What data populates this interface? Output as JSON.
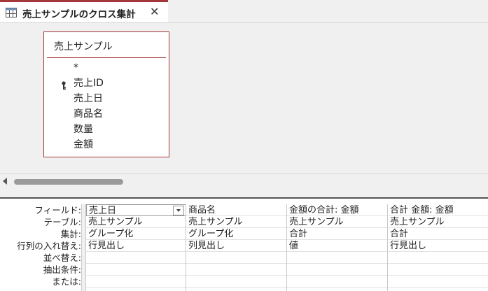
{
  "tab": {
    "title": "売上サンプルのクロス集計",
    "close": "✕"
  },
  "table_box": {
    "title": "売上サンプル",
    "fields": [
      "*",
      "売上ID",
      "売上日",
      "商品名",
      "数量",
      "金額"
    ],
    "primary_key": "売上ID"
  },
  "grid": {
    "row_labels": [
      "フィールド:",
      "テーブル:",
      "集計:",
      "行列の入れ替え:",
      "並べ替え:",
      "抽出条件:",
      "または:"
    ],
    "columns": [
      {
        "field": "売上日",
        "table": "売上サンプル",
        "total": "グループ化",
        "crosstab": "行見出し",
        "sort": "",
        "criteria": "",
        "or": ""
      },
      {
        "field": "商品名",
        "table": "売上サンプル",
        "total": "グループ化",
        "crosstab": "列見出し",
        "sort": "",
        "criteria": "",
        "or": ""
      },
      {
        "field": "金額の合計: 金額",
        "table": "売上サンプル",
        "total": "合計",
        "crosstab": "値",
        "sort": "",
        "criteria": "",
        "or": ""
      },
      {
        "field": "合計 金額: 金額",
        "table": "売上サンプル",
        "total": "合計",
        "crosstab": "行見出し",
        "sort": "",
        "criteria": "",
        "or": ""
      }
    ]
  },
  "colors": {
    "accent": "#a4373a",
    "panel": "#f0f0f0"
  }
}
